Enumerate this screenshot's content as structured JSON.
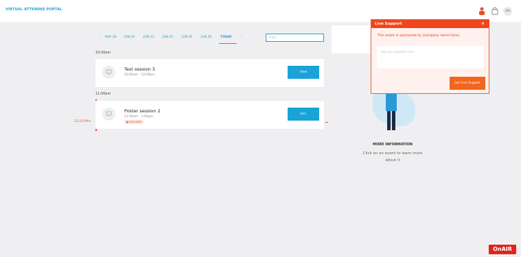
{
  "header": {
    "brand": "VIRTUAL ATTENDEE PORTAL",
    "lang": "EN",
    "icons": [
      "user-icon",
      "bag-icon"
    ]
  },
  "dates": {
    "prev_arrow": "‹",
    "items": [
      "MAY 28",
      "JUN 19",
      "JUN 23",
      "JUN 25",
      "JUN 29",
      "JUN 30",
      "TODAY"
    ],
    "next_arrow": "›",
    "active": "TODAY"
  },
  "filter": {
    "placeholder": "Filter"
  },
  "schedule": [
    {
      "time": "10:00am",
      "title": "Test session 5",
      "range": "10:00am - 12:00pm",
      "action": "View"
    },
    {
      "time": "11:00am",
      "title": "Poster session 2",
      "range": "11:00am - 1:00pm",
      "badge": "● LIVE NOW",
      "action": "Join"
    }
  ],
  "now_marker": "12:23 PM ▸",
  "info": {
    "title": "MORE INFORMATION",
    "text": "Click on an event to learn more about it"
  },
  "support": {
    "title": "Live Support",
    "close": "×",
    "message": "This event is sponsored by [company name here]",
    "input_placeholder": "Ask your question here",
    "button": "Get Live Support"
  },
  "logo": "OnAIR",
  "colors": {
    "accent": "#1aa3d6",
    "support": "#f0461e",
    "logo": "#e3231a"
  }
}
